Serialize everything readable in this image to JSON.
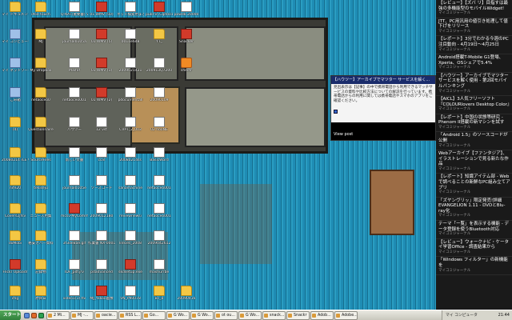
{
  "desktop_icons": [
    {
      "label": "マイ ドキュメント",
      "type": "folder",
      "col": 0,
      "row": 0
    },
    {
      "label": "マイ コンピュータ",
      "type": "sys",
      "col": 0,
      "row": 1
    },
    {
      "label": "マイ ネットワーク",
      "type": "sys",
      "col": 0,
      "row": 2
    },
    {
      "label": "ごみ箱",
      "type": "sys",
      "col": 0,
      "row": 3
    },
    {
      "label": "(4)",
      "type": "folder",
      "col": 0,
      "row": 4
    },
    {
      "label": "20080214 iCE WF用 画像",
      "type": "folder",
      "col": 0,
      "row": 5
    },
    {
      "label": "nife20",
      "type": "folder",
      "col": 0,
      "row": 6
    },
    {
      "label": "Covers2jfsv",
      "type": "folder",
      "col": 0,
      "row": 7
    },
    {
      "label": "doMobi",
      "type": "folder",
      "col": 0,
      "row": 8
    },
    {
      "label": "Flickr Uploadr",
      "type": "app",
      "col": 0,
      "row": 9
    },
    {
      "label": "img",
      "type": "folder",
      "col": 0,
      "row": 10
    },
    {
      "label": "iPod touch",
      "type": "folder",
      "col": 1,
      "row": 0
    },
    {
      "label": "MJ",
      "type": "folder",
      "col": 1,
      "row": 1
    },
    {
      "label": "My Dropbox",
      "type": "folder",
      "col": 1,
      "row": 2
    },
    {
      "label": "netaoceo0",
      "type": "folder",
      "col": 1,
      "row": 3
    },
    {
      "label": "Questionnaire",
      "type": "folder",
      "col": 1,
      "row": 4
    },
    {
      "label": "SourceFiles",
      "type": "folder",
      "col": 1,
      "row": 5
    },
    {
      "label": "tekiseju",
      "type": "folder",
      "col": 1,
      "row": 6
    },
    {
      "label": "ニュース用集",
      "type": "folder",
      "col": 1,
      "row": 7
    },
    {
      "label": "格安カバー資料",
      "type": "folder",
      "col": 1,
      "row": 8
    },
    {
      "label": "記録物",
      "type": "folder",
      "col": 1,
      "row": 9
    },
    {
      "label": "原目日",
      "type": "folder",
      "col": 1,
      "row": 10
    },
    {
      "label": "Q-KAT(重要書) Ver.6 入門",
      "type": "doc",
      "col": 2,
      "row": 0
    },
    {
      "label": "journal0105a",
      "type": "doc",
      "col": 2,
      "row": 1
    },
    {
      "label": "M.bfaf",
      "type": "doc",
      "col": 2,
      "row": 2
    },
    {
      "label": "netaoceo001",
      "type": "doc",
      "col": 2,
      "row": 3
    },
    {
      "label": "ハウツー",
      "type": "doc",
      "col": 2,
      "row": 4
    },
    {
      "label": "新しい文書",
      "type": "doc",
      "col": 2,
      "row": 5
    },
    {
      "label": "journal0105e",
      "type": "doc",
      "col": 2,
      "row": 6
    },
    {
      "label": "mcsv-MyComm",
      "type": "app",
      "col": 2,
      "row": 7
    },
    {
      "label": "3f3de8ae.gif",
      "type": "doc",
      "col": 2,
      "row": 8
    },
    {
      "label": "IDF_pdf.jrv",
      "type": "doc",
      "col": 2,
      "row": 9
    },
    {
      "label": "video1(1).flv",
      "type": "doc",
      "col": 2,
      "row": 10
    },
    {
      "label": "01 WMV (50)",
      "type": "app",
      "col": 3,
      "row": 0
    },
    {
      "label": "01 WMV (5)",
      "type": "app",
      "col": 3,
      "row": 1
    },
    {
      "label": "01 WMV (1)",
      "type": "app",
      "col": 3,
      "row": 2
    },
    {
      "label": "01 WMV (2)",
      "type": "app",
      "col": 3,
      "row": 3
    },
    {
      "label": "12 vst",
      "type": "doc",
      "col": 3,
      "row": 4
    },
    {
      "label": "ccnl",
      "type": "doc",
      "col": 3,
      "row": 5
    },
    {
      "label": "ソースコード",
      "type": "doc",
      "col": 3,
      "row": 6
    },
    {
      "label": "2009012180",
      "type": "doc",
      "col": 3,
      "row": 7
    },
    {
      "label": "作業書 NX-0001",
      "type": "doc",
      "col": 3,
      "row": 8
    },
    {
      "label": "pdadvanced",
      "type": "doc",
      "col": 3,
      "row": 9
    },
    {
      "label": "MJ_Yakoo画像",
      "type": "app",
      "col": 3,
      "row": 10
    },
    {
      "label": "ネット検索用まとめ",
      "type": "doc",
      "col": 4,
      "row": 0
    },
    {
      "label": "0011e6d8",
      "type": "doc",
      "col": 4,
      "row": 1
    },
    {
      "label": "2009021421",
      "type": "doc",
      "col": 4,
      "row": 2
    },
    {
      "label": "pdocumentall",
      "type": "doc",
      "col": 4,
      "row": 3
    },
    {
      "label": "CVPT_2_003",
      "type": "doc",
      "col": 4,
      "row": 4
    },
    {
      "label": "20080214ss",
      "type": "doc",
      "col": 4,
      "row": 5
    },
    {
      "label": "sanamachine",
      "type": "doc",
      "col": 4,
      "row": 6
    },
    {
      "label": "reviewnewsi",
      "type": "doc",
      "col": 4,
      "row": 7
    },
    {
      "label": "linkies_2008",
      "type": "doc",
      "col": 4,
      "row": 8
    },
    {
      "label": "skdsetup.exe",
      "type": "app",
      "col": 4,
      "row": 9
    },
    {
      "label": "VN_P90078",
      "type": "doc",
      "col": 4,
      "row": 10
    },
    {
      "label": "pubr-in Cqito01",
      "type": "app",
      "col": 5,
      "row": 0
    },
    {
      "label": "YT_",
      "type": "folder",
      "col": 5,
      "row": 1
    },
    {
      "label": "200913Q7200",
      "type": "doc",
      "col": 5,
      "row": 2
    },
    {
      "label": "20090109",
      "type": "doc",
      "col": 5,
      "row": 3
    },
    {
      "label": "02 hooNE",
      "type": "doc",
      "col": 5,
      "row": 4
    },
    {
      "label": "BasicWord",
      "type": "doc",
      "col": 5,
      "row": 5
    },
    {
      "label": "netaoceo001",
      "type": "doc",
      "col": 5,
      "row": 6
    },
    {
      "label": "netaoceo001",
      "type": "doc",
      "col": 5,
      "row": 7
    },
    {
      "label": "2009042612",
      "type": "doc",
      "col": 5,
      "row": 8
    },
    {
      "label": "mashurrbe",
      "type": "doc",
      "col": 5,
      "row": 9
    },
    {
      "label": "Bc_b",
      "type": "folder",
      "col": 5,
      "row": 10
    },
    {
      "label": "powdb 20000",
      "type": "doc",
      "col": 6,
      "row": 0
    },
    {
      "label": "Snacker",
      "type": "app",
      "col": 6,
      "row": 1
    },
    {
      "label": "shectr",
      "type": "rss",
      "col": 6,
      "row": 2
    },
    {
      "label": "20090416",
      "type": "folder",
      "col": 6,
      "row": 10
    }
  ],
  "popup": {
    "title": "【ハウツー】アーカイブでマツター サービスを解く...",
    "body": "見出表示は【記事】の中で携帯電話から利用できるマッチサービスの資料や比較方法についての解説を行っています。携帯電話からの利用に関しては携帯電話やスマホのアプリをご確認ください。",
    "footer_label": "View post"
  },
  "sidebar": {
    "items": [
      {
        "title": "【レビュー】【ズバ リ】目指すは最強の多機能型のモバイルWidget!",
        "source": "マイコミジャーナル"
      },
      {
        "title": "JTT、PC用汎用の値引き処理して値下げをリリース",
        "source": "マイコミジャーナル"
      },
      {
        "title": "【レポート】3分でわかる今週のPC注目動向 - 4月19日〜4月25日",
        "source": "マイコミジャーナル"
      },
      {
        "title": "Android搭載T-Mobile G1登場、Xperia、OSシェアで5.4%",
        "source": "マイコミジャーナル"
      },
      {
        "title": "【ハウツー】アーカイブでマツターサービスを解く使用 - 第2回モバイルバンキング",
        "source": "マイコミジャーナル"
      },
      {
        "title": "【AICL】3人気フリーソフト『COLOURlovers Desktop Color』",
        "source": "マイコミジャーナル"
      },
      {
        "title": "【レポート】中国の状態等研究 - Phenom II搭載の新マシンを試す",
        "source": "マイコミジャーナル"
      },
      {
        "title": "「Android 1.5」のソースコードが公開",
        "source": "マイコミジャーナル"
      },
      {
        "title": "Webアーカイブ【ファンタジア】、イラストレーションで見る新たな作品",
        "source": "マイコミジャーナル"
      },
      {
        "title": "【レポート】知識アイテム部 - Webで調べることの新鮮なPC組み立てアプリ",
        "source": "マイコミジャーナル"
      },
      {
        "title": "「ズヤンヴリッ」限定発売!詳細EVANGELION 1.11 - DVDとBlu-ray化",
        "source": "マイコミジャーナル"
      },
      {
        "title": "テーマ「ー覧」を表示する機能 - データ登録を使うBluetooth対応",
        "source": "マイコミジャーナル"
      },
      {
        "title": "【レビュー】ウォークナビ・ケータイ学習Office - 調査結果から",
        "source": "マイコミジャーナル"
      },
      {
        "title": "「Windows フィルター」の新機能を",
        "source": "マイコミジャーナル"
      }
    ]
  },
  "taskbar": {
    "start_label": "スタート",
    "buttons": [
      "2 Mi...",
      "MJ -...",
      "oacie...",
      "RSS L...",
      "Go...",
      "G Wo...",
      "G Wo...",
      "ot ou...",
      "G Wo...",
      "snack...",
      "Snackr",
      "Adob...",
      "Adobe..."
    ],
    "tray_label": "マイ コンピュータ",
    "clock": "21:44"
  }
}
